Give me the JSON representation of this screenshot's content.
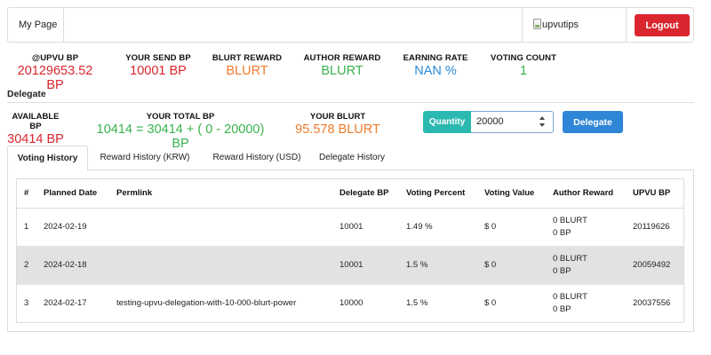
{
  "navbar": {
    "brand": "My Page",
    "username": "upvutips",
    "logout_label": "Logout"
  },
  "stats": [
    {
      "label": "@UPVU BP",
      "value": "20129653.52 BP",
      "color": "#d9262f"
    },
    {
      "label": "YOUR SEND BP",
      "value": "10001 BP",
      "color": "#d9262f"
    },
    {
      "label": "BLURT REWARD",
      "value": "BLURT",
      "color": "#f07a2b"
    },
    {
      "label": "AUTHOR REWARD",
      "value": "BLURT",
      "color": "#37b24d"
    },
    {
      "label": "EARNING RATE",
      "value": "NAN %",
      "color": "#2a8bd2"
    },
    {
      "label": "VOTING COUNT",
      "value": "1",
      "color": "#37b24d"
    }
  ],
  "delegate_section": {
    "title": "Delegate",
    "available_label": "AVAILABLE BP",
    "available_value": "30414 BP",
    "total_label": "YOUR TOTAL BP",
    "total_value": "10414 = 30414 + ( 0 - 20000) BP",
    "blurt_label": "YOUR BLURT",
    "blurt_value": "95.578 BLURT",
    "quantity_label": "Quantity",
    "quantity_value": "20000",
    "delegate_button": "Delegate"
  },
  "tabs": [
    {
      "label": "Voting History",
      "active": true
    },
    {
      "label": "Reward History (KRW)",
      "active": false
    },
    {
      "label": "Reward History (USD)",
      "active": false
    },
    {
      "label": "Delegate History",
      "active": false
    }
  ],
  "table": {
    "headers": [
      "#",
      "Planned Date",
      "Permlink",
      "Delegate BP",
      "Voting Percent",
      "Voting Value",
      "Author Reward",
      "UPVU BP"
    ],
    "rows": [
      {
        "num": "1",
        "date": "2024-02-19",
        "permlink": "",
        "delegate_bp": "10001",
        "voting_percent": "1.49 %",
        "voting_value": "$ 0",
        "reward_blurt": "0 BLURT",
        "reward_bp": "0 BP",
        "upvu_bp": "20119626"
      },
      {
        "num": "2",
        "date": "2024-02-18",
        "permlink": "",
        "delegate_bp": "10001",
        "voting_percent": "1.5 %",
        "voting_value": "$ 0",
        "reward_blurt": "0 BLURT",
        "reward_bp": "0 BP",
        "upvu_bp": "20059492"
      },
      {
        "num": "3",
        "date": "2024-02-17",
        "permlink": "testing-upvu-delegation-with-10-000-blurt-power",
        "delegate_bp": "10000",
        "voting_percent": "1.5 %",
        "voting_value": "$ 0",
        "reward_blurt": "0 BLURT",
        "reward_bp": "0 BP",
        "upvu_bp": "20037556"
      }
    ]
  }
}
